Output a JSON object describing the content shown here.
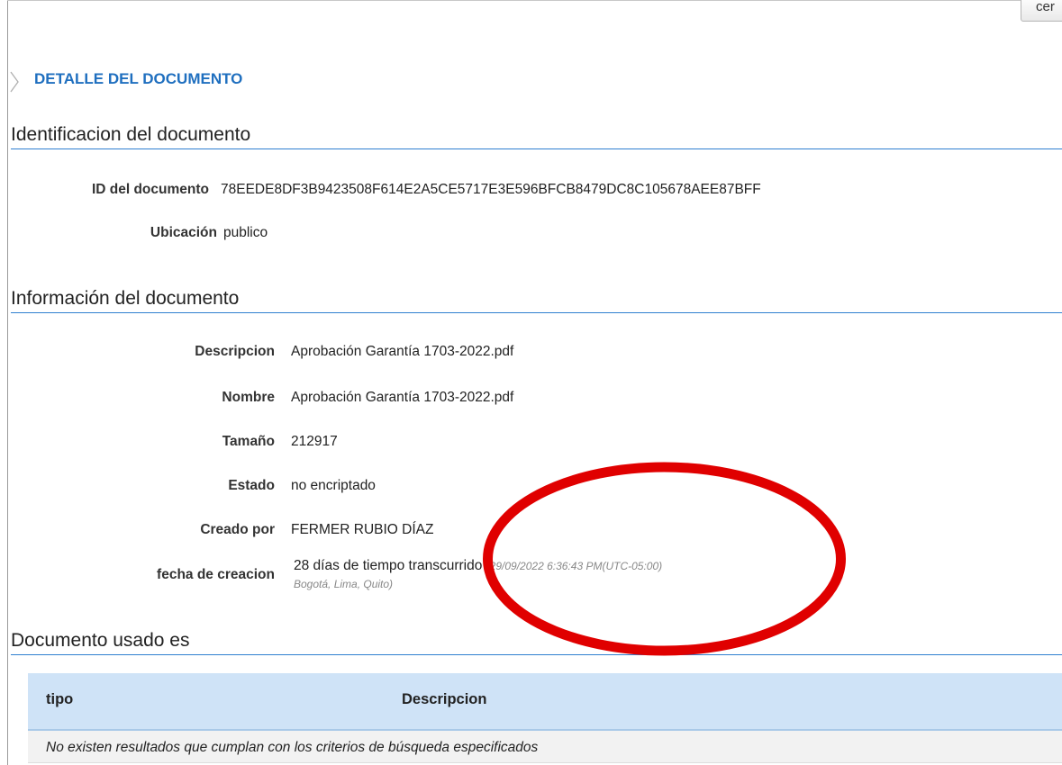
{
  "toolbar": {
    "top_button_label": "cer"
  },
  "page": {
    "heading": "DETALLE DEL DOCUMENTO"
  },
  "sections": {
    "identification": {
      "title": "Identificacion del documento",
      "fields": {
        "id_label": "ID del documento",
        "id_value": "78EEDE8DF3B9423508F614E2A5CE5717E3E596BFCB8479DC8C105678AEE87BFF",
        "location_label": "Ubicación",
        "location_value": "publico"
      }
    },
    "information": {
      "title": "Información del documento",
      "fields": {
        "description_label": "Descripcion",
        "description_value": "Aprobación Garantía 1703-2022.pdf",
        "name_label": "Nombre",
        "name_value": "Aprobación Garantía 1703-2022.pdf",
        "size_label": "Tamaño",
        "size_value": "212917",
        "status_label": "Estado",
        "status_value": "no encriptado",
        "created_by_label": "Creado por",
        "created_by_value": "FERMER RUBIO DÍAZ",
        "creation_date_label": "fecha de creacion",
        "creation_date_elapsed": "28 días de tiempo transcurrido",
        "creation_date_timestamp": "(29/09/2022 6:36:43 PM(UTC-05:00)",
        "creation_date_timezone": "Bogotá, Lima, Quito)"
      }
    },
    "usage": {
      "title": "Documento usado es",
      "table": {
        "columns": [
          "tipo",
          "Descripcion"
        ],
        "empty_message": "No existen resultados que cumplan con los criterios de búsqueda especificados"
      }
    }
  },
  "annotation": {
    "color": "#e00000"
  },
  "colors": {
    "heading_blue": "#1f6fbf",
    "section_rule": "#2f7fd0",
    "table_header_bg": "#cfe3f7"
  },
  "icons": {
    "breadcrumb": "chevron-right-icon"
  }
}
